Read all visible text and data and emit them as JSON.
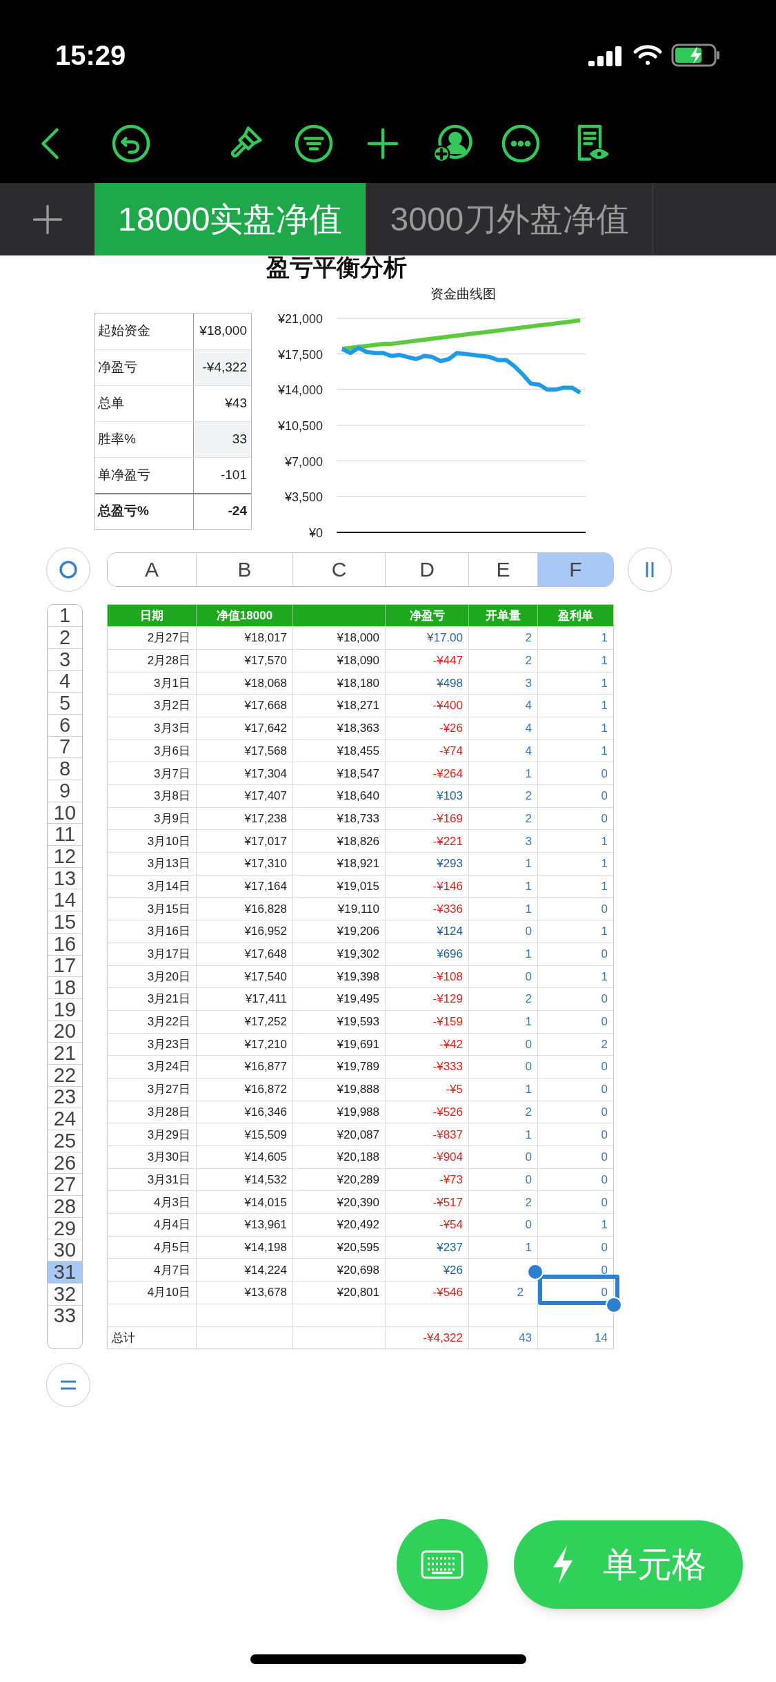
{
  "status_bar": {
    "time": "15:29"
  },
  "sheet_tabs": [
    {
      "label": "18000实盘净值",
      "selected": true
    },
    {
      "label": "3000刀外盘净值",
      "selected": false
    }
  ],
  "title": "盈亏平衡分析",
  "summary": [
    {
      "label": "起始资金",
      "value": "¥18,000",
      "shaded": false,
      "bold": false
    },
    {
      "label": "净盈亏",
      "value": "-¥4,322",
      "shaded": true,
      "bold": false
    },
    {
      "label": "总单",
      "value": "¥43",
      "shaded": false,
      "bold": false
    },
    {
      "label": "胜率%",
      "value": "33",
      "shaded": true,
      "bold": false
    },
    {
      "label": "单净盈亏",
      "value": "-101",
      "shaded": false,
      "bold": false
    },
    {
      "label": "总盈亏%",
      "value": "-24",
      "shaded": false,
      "bold": true
    }
  ],
  "chart": {
    "chart_data": {
      "type": "line",
      "title": "资金曲线图",
      "grid": true,
      "series": [
        {
          "color": "#5cc93e",
          "values": [
            18000,
            18100,
            18200,
            18300,
            18400,
            18500,
            18500,
            18600,
            18700,
            18800,
            18900,
            19000,
            19100,
            19200,
            19300,
            19400,
            19500,
            19600,
            19700,
            19800,
            19900,
            20000,
            20100,
            20200,
            20300,
            20400,
            20500,
            20600,
            20700,
            20800
          ]
        },
        {
          "color": "#1f9be6",
          "values": [
            18000,
            17600,
            18100,
            17700,
            17600,
            17600,
            17300,
            17400,
            17200,
            17000,
            17300,
            17200,
            16800,
            17000,
            17600,
            17500,
            17400,
            17300,
            17200,
            16900,
            16900,
            16300,
            15500,
            14600,
            14500,
            14000,
            14000,
            14200,
            14200,
            13700
          ]
        }
      ],
      "ylim": [
        0,
        21000
      ],
      "yticks": [
        {
          "value": 0,
          "label": "¥0"
        },
        {
          "value": 3500,
          "label": "¥3,500"
        },
        {
          "value": 7000,
          "label": "¥7,000"
        },
        {
          "value": 10500,
          "label": "¥10,500"
        },
        {
          "value": 14000,
          "label": "¥14,000"
        },
        {
          "value": 17500,
          "label": "¥17,500"
        },
        {
          "value": 21000,
          "label": "¥21,000"
        }
      ]
    }
  },
  "column_headers": [
    {
      "label": "A",
      "selected": false
    },
    {
      "label": "B",
      "selected": false
    },
    {
      "label": "C",
      "selected": false
    },
    {
      "label": "D",
      "selected": false
    },
    {
      "label": "E",
      "selected": false
    },
    {
      "label": "F",
      "selected": true
    }
  ],
  "row_headers": [
    {
      "label": "1",
      "selected": false
    },
    {
      "label": "2",
      "selected": false
    },
    {
      "label": "3",
      "selected": false
    },
    {
      "label": "4",
      "selected": false
    },
    {
      "label": "5",
      "selected": false
    },
    {
      "label": "6",
      "selected": false
    },
    {
      "label": "7",
      "selected": false
    },
    {
      "label": "8",
      "selected": false
    },
    {
      "label": "9",
      "selected": false
    },
    {
      "label": "10",
      "selected": false
    },
    {
      "label": "11",
      "selected": false
    },
    {
      "label": "12",
      "selected": false
    },
    {
      "label": "13",
      "selected": false
    },
    {
      "label": "14",
      "selected": false
    },
    {
      "label": "15",
      "selected": false
    },
    {
      "label": "16",
      "selected": false
    },
    {
      "label": "17",
      "selected": false
    },
    {
      "label": "18",
      "selected": false
    },
    {
      "label": "19",
      "selected": false
    },
    {
      "label": "20",
      "selected": false
    },
    {
      "label": "21",
      "selected": false
    },
    {
      "label": "22",
      "selected": false
    },
    {
      "label": "23",
      "selected": false
    },
    {
      "label": "24",
      "selected": false
    },
    {
      "label": "25",
      "selected": false
    },
    {
      "label": "26",
      "selected": false
    },
    {
      "label": "27",
      "selected": false
    },
    {
      "label": "28",
      "selected": false
    },
    {
      "label": "29",
      "selected": false
    },
    {
      "label": "30",
      "selected": false
    },
    {
      "label": "31",
      "selected": true
    },
    {
      "label": "32",
      "selected": false
    },
    {
      "label": "33",
      "selected": false
    }
  ],
  "table": {
    "columns": [
      "日期",
      "净值18000",
      null,
      "净盈亏",
      "开单量",
      "盈利单"
    ],
    "rows": [
      {
        "cells": [
          "2月27日",
          "¥18,017",
          "¥18,000",
          "¥17.00",
          "2",
          "1"
        ],
        "loss": false
      },
      {
        "cells": [
          "2月28日",
          "¥17,570",
          "¥18,090",
          "-¥447",
          "2",
          "1"
        ],
        "loss": true
      },
      {
        "cells": [
          "3月1日",
          "¥18,068",
          "¥18,180",
          "¥498",
          "3",
          "1"
        ],
        "loss": false
      },
      {
        "cells": [
          "3月2日",
          "¥17,668",
          "¥18,271",
          "-¥400",
          "4",
          "1"
        ],
        "loss": true
      },
      {
        "cells": [
          "3月3日",
          "¥17,642",
          "¥18,363",
          "-¥26",
          "4",
          "1"
        ],
        "loss": true
      },
      {
        "cells": [
          "3月6日",
          "¥17,568",
          "¥18,455",
          "-¥74",
          "4",
          "1"
        ],
        "loss": true
      },
      {
        "cells": [
          "3月7日",
          "¥17,304",
          "¥18,547",
          "-¥264",
          "1",
          "0"
        ],
        "loss": true
      },
      {
        "cells": [
          "3月8日",
          "¥17,407",
          "¥18,640",
          "¥103",
          "2",
          "0"
        ],
        "loss": false
      },
      {
        "cells": [
          "3月9日",
          "¥17,238",
          "¥18,733",
          "-¥169",
          "2",
          "0"
        ],
        "loss": true
      },
      {
        "cells": [
          "3月10日",
          "¥17,017",
          "¥18,826",
          "-¥221",
          "3",
          "1"
        ],
        "loss": true
      },
      {
        "cells": [
          "3月13日",
          "¥17,310",
          "¥18,921",
          "¥293",
          "1",
          "1"
        ],
        "loss": false
      },
      {
        "cells": [
          "3月14日",
          "¥17,164",
          "¥19,015",
          "-¥146",
          "1",
          "1"
        ],
        "loss": true
      },
      {
        "cells": [
          "3月15日",
          "¥16,828",
          "¥19,110",
          "-¥336",
          "1",
          "0"
        ],
        "loss": true
      },
      {
        "cells": [
          "3月16日",
          "¥16,952",
          "¥19,206",
          "¥124",
          "0",
          "1"
        ],
        "loss": false
      },
      {
        "cells": [
          "3月17日",
          "¥17,648",
          "¥19,302",
          "¥696",
          "1",
          "0"
        ],
        "loss": false
      },
      {
        "cells": [
          "3月20日",
          "¥17,540",
          "¥19,398",
          "-¥108",
          "0",
          "1"
        ],
        "loss": true
      },
      {
        "cells": [
          "3月21日",
          "¥17,411",
          "¥19,495",
          "-¥129",
          "2",
          "0"
        ],
        "loss": true
      },
      {
        "cells": [
          "3月22日",
          "¥17,252",
          "¥19,593",
          "-¥159",
          "1",
          "0"
        ],
        "loss": true
      },
      {
        "cells": [
          "3月23日",
          "¥17,210",
          "¥19,691",
          "-¥42",
          "0",
          "2"
        ],
        "loss": true
      },
      {
        "cells": [
          "3月24日",
          "¥16,877",
          "¥19,789",
          "-¥333",
          "0",
          "0"
        ],
        "loss": true
      },
      {
        "cells": [
          "3月27日",
          "¥16,872",
          "¥19,888",
          "-¥5",
          "1",
          "0"
        ],
        "loss": true
      },
      {
        "cells": [
          "3月28日",
          "¥16,346",
          "¥19,988",
          "-¥526",
          "2",
          "0"
        ],
        "loss": true
      },
      {
        "cells": [
          "3月29日",
          "¥15,509",
          "¥20,087",
          "-¥837",
          "1",
          "0"
        ],
        "loss": true
      },
      {
        "cells": [
          "3月30日",
          "¥14,605",
          "¥20,188",
          "-¥904",
          "0",
          "0"
        ],
        "loss": true
      },
      {
        "cells": [
          "3月31日",
          "¥14,532",
          "¥20,289",
          "-¥73",
          "0",
          "0"
        ],
        "loss": true
      },
      {
        "cells": [
          "4月3日",
          "¥14,015",
          "¥20,390",
          "-¥517",
          "2",
          "0"
        ],
        "loss": true
      },
      {
        "cells": [
          "4月4日",
          "¥13,961",
          "¥20,492",
          "-¥54",
          "0",
          "1"
        ],
        "loss": true
      },
      {
        "cells": [
          "4月5日",
          "¥14,198",
          "¥20,595",
          "¥237",
          "1",
          "0"
        ],
        "loss": false
      },
      {
        "cells": [
          "4月7日",
          "¥14,224",
          "¥20,698",
          "¥26",
          null,
          "0"
        ],
        "loss": false
      },
      {
        "cells": [
          "4月10日",
          "¥13,678",
          "¥20,801",
          "-¥546",
          "2",
          "0"
        ],
        "loss": true
      },
      {
        "cells": [
          null,
          null,
          null,
          null,
          null,
          null
        ]
      },
      {
        "cells": [
          "总计",
          null,
          null,
          "-¥4,322",
          "43",
          "14"
        ],
        "loss": true,
        "kind": "total"
      }
    ]
  },
  "cell_button": {
    "label": "单元格"
  }
}
